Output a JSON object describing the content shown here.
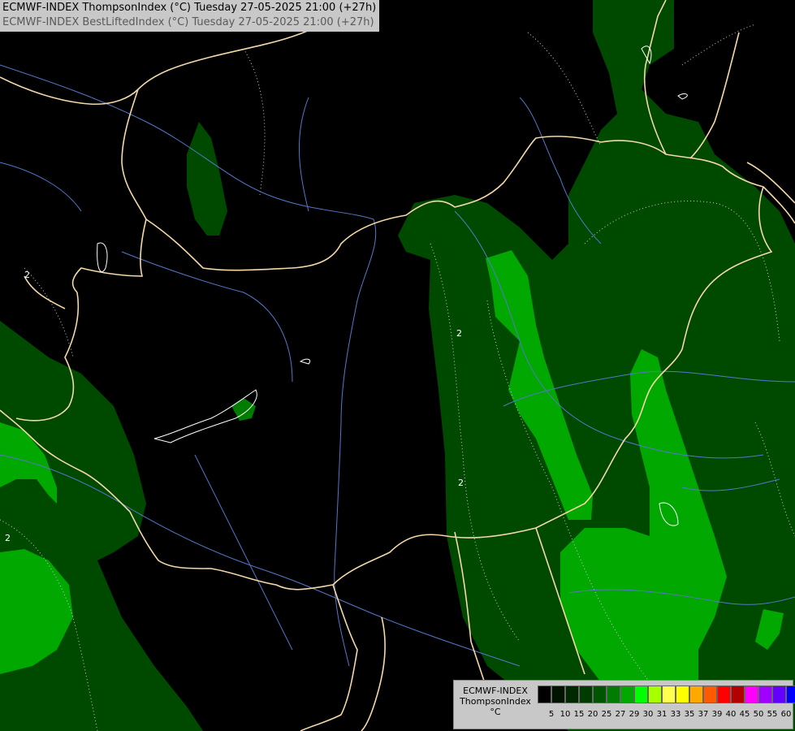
{
  "title": {
    "line1": "ECMWF-INDEX ThompsonIndex (°C) Tuesday 27-05-2025 21:00 (+27h)",
    "line2": "ECMWF-INDEX BestLiftedIndex (°C) Tuesday 27-05-2025 21:00 (+27h)",
    "line1_color": "#000000",
    "line2_color": "#5a5a5a"
  },
  "legend": {
    "label1": "ECMWF-INDEX",
    "label2": "ThompsonIndex",
    "label3": "°C",
    "values": [
      "5",
      "10",
      "15",
      "20",
      "25",
      "27",
      "29",
      "30",
      "31",
      "33",
      "35",
      "37",
      "39",
      "40",
      "45",
      "50",
      "55",
      "60"
    ],
    "colors": [
      "#000000",
      "#001400",
      "#002800",
      "#003c00",
      "#005500",
      "#007d00",
      "#00a800",
      "#00ff00",
      "#a8ff00",
      "#ffff50",
      "#ffff00",
      "#ffa800",
      "#ff5a00",
      "#ff0000",
      "#b40000",
      "#ff00ff",
      "#a000ff",
      "#6400ff",
      "#0000ff"
    ]
  },
  "contour_labels": [
    "2",
    "2",
    "2",
    "2"
  ],
  "colors": {
    "background": "#000000",
    "zone_dark_green": "#004a00",
    "zone_mid_green": "#007d00",
    "zone_bright_green": "#00a800",
    "border": "#f5d8a8",
    "river": "#5577cc"
  }
}
